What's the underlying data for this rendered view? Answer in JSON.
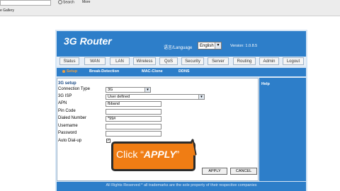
{
  "browser": {
    "search_label": "Search",
    "more_label": "More",
    "gallery_label": "e Gallery"
  },
  "router": {
    "brand": "3G Router",
    "language_label": "语言/Language",
    "language_value": "English",
    "version": "Version: 1.0.8.5",
    "tabs": [
      "Status",
      "WAN",
      "LAN",
      "Wireless",
      "QoS",
      "Security",
      "Server",
      "Routing",
      "Admin",
      "Logout"
    ],
    "subtabs": [
      "Setup",
      "Break-Detection",
      "MAC-Clone",
      "DDNS"
    ],
    "section_title": "3G setup",
    "fields": {
      "connection_type_label": "Connection Type",
      "connection_type_value": "3G",
      "isp_label": "3G ISP",
      "isp_value": "User defined",
      "apn_label": "APN",
      "apn_value": "fbband",
      "pin_label": "Pin Code",
      "pin_value": "",
      "dialed_label": "Dialed Number",
      "dialed_value": "*99#",
      "username_label": "Username",
      "username_value": "",
      "password_label": "Password",
      "password_value": "",
      "autodial_label": "Auto Dial-up",
      "autodial_checked": true
    },
    "apply_label": "APPLY",
    "cancel_label": "CANCEL",
    "help_title": "Help",
    "footer": "All Rights Reserved * all trademarks are the sole property of their respective companies"
  },
  "callout": {
    "prefix": "Click ",
    "quote_open": "“",
    "action": "APPLY",
    "quote_close": "”"
  },
  "colors": {
    "brand_blue": "#2d7ec9",
    "callout_orange": "#f07d14",
    "active_subtab": "#f0a040"
  }
}
